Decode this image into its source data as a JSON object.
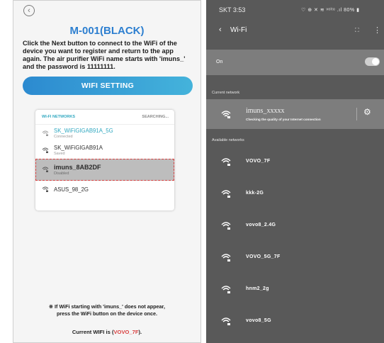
{
  "left": {
    "back_icon": "chevron-left-icon",
    "title": "M-001(BLACK)",
    "description": "Click the Next button to connect to the WiFi of the device you want to register and return to the app again. The air purifier WiFi name starts with 'imuns_' and the password is 11111111.",
    "wifi_setting_label": "WIFI SETTING",
    "wifi_card": {
      "header_left": "WI-FI NETWORKS",
      "header_right": "SEARCHING...",
      "networks": [
        {
          "name": "SK_WiFiGIGAB91A_5G",
          "status": "Connected"
        },
        {
          "name": "SK_WiFiGIGAB91A",
          "status": "Saved"
        },
        {
          "name": "imuns_8AB2DF",
          "status": "Disabled"
        },
        {
          "name": "ASUS_98_2G",
          "status": ""
        }
      ]
    },
    "note_line1": "※ If WiFi starting with 'imuns_' does not appear,",
    "note_line2": "press the WiFi button on the device once.",
    "current_prefix": "Current WIFI is (",
    "current_wifi": "VOVO_7F",
    "current_suffix": ")."
  },
  "right": {
    "status_time": "SKT 3:53",
    "status_icons": "♡  ⊕ ✕ ≋ ᵛᵒˡᵗᵉ .ıl 80% ▮",
    "title": "Wi-Fi",
    "on_label": "On",
    "current_section": "Current network",
    "current_network_name": "imuns_xxxxx",
    "current_network_status": "Checking the quality of your Internet connection",
    "available_section": "Available networks",
    "available": [
      "VOVO_7F",
      "kkk-2G",
      "vovo8_2.4G",
      "VOVO_5G_7F",
      "hnm2_2g",
      "vovo8_5G"
    ]
  },
  "colors": {
    "accent_blue": "#2d7fd0",
    "highlight_red": "#d94040",
    "panel_gray": "#595959",
    "row_gray": "#7d7d7d"
  }
}
